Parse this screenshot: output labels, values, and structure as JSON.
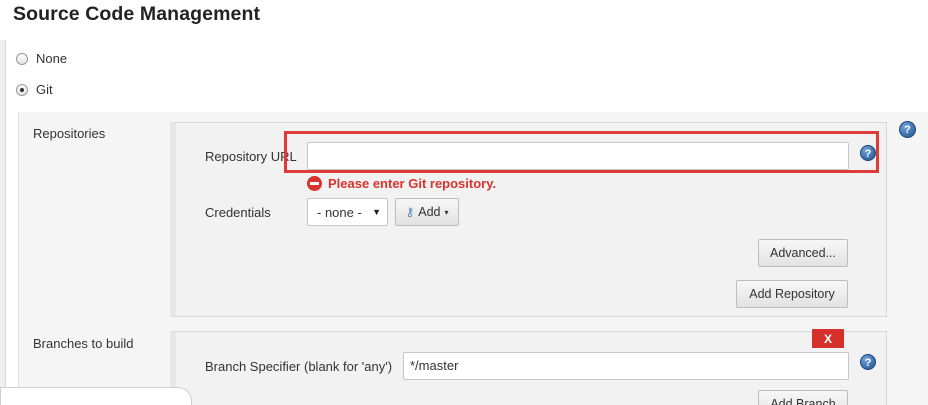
{
  "section": {
    "title": "Source Code Management"
  },
  "scm_options": [
    {
      "label": "None",
      "checked": false
    },
    {
      "label": "Git",
      "checked": true
    }
  ],
  "repositories": {
    "label": "Repositories",
    "url_label": "Repository URL",
    "url_value": "",
    "error": "Please enter Git repository.",
    "credentials_label": "Credentials",
    "credentials_value": "- none -",
    "add_label": "Add",
    "advanced_label": "Advanced...",
    "add_repository_label": "Add Repository"
  },
  "branches": {
    "label": "Branches to build",
    "delete_label": "X",
    "specifier_label": "Branch Specifier (blank for 'any')",
    "specifier_value": "*/master",
    "add_branch_label": "Add Branch"
  },
  "icons": {
    "help": "help-icon",
    "error": "error-icon",
    "key": "key-icon",
    "caret": "chevron-down-icon"
  },
  "colors": {
    "error": "#d9332d",
    "highlight": "#e03b3b",
    "help": "#20528e"
  }
}
